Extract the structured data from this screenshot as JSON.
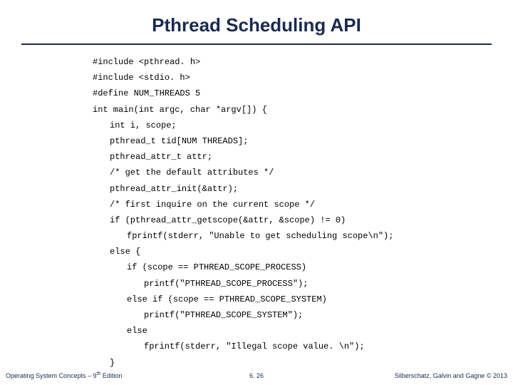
{
  "title": "Pthread Scheduling API",
  "code": {
    "l1": "#include <pthread. h>",
    "l2": "#include <stdio. h>",
    "l3": "#define NUM_THREADS 5",
    "l4": "int main(int argc, char *argv[]) {",
    "l5": "int i, scope;",
    "l6": "pthread_t tid[NUM THREADS];",
    "l7": "pthread_attr_t attr;",
    "l8": "/* get the default attributes */",
    "l9": "pthread_attr_init(&attr);",
    "l10": "/* first inquire on the current scope */",
    "l11": "if (pthread_attr_getscope(&attr, &scope) != 0)",
    "l12": "fprintf(stderr, \"Unable to get scheduling scope\\n\");",
    "l13": "else {",
    "l14": "if (scope == PTHREAD_SCOPE_PROCESS)",
    "l15": "printf(\"PTHREAD_SCOPE_PROCESS\");",
    "l16": "else if (scope == PTHREAD_SCOPE_SYSTEM)",
    "l17": "printf(\"PTHREAD_SCOPE_SYSTEM\");",
    "l18": "else",
    "l19": "fprintf(stderr, \"Illegal scope value. \\n\");",
    "l20": "}"
  },
  "footer": {
    "left_a": "Operating System Concepts – 9",
    "left_sup": "th",
    "left_b": " Edition",
    "center": "6. 26",
    "right": "Silberschatz, Galvin and Gagne © 2013"
  }
}
